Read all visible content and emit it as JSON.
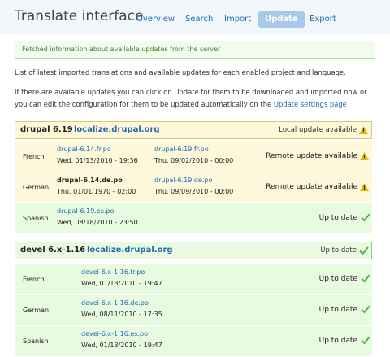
{
  "header": {
    "title": "Translate interface",
    "tabs": [
      "Overview",
      "Search",
      "Import",
      "Update",
      "Export"
    ],
    "active_tab": "Update"
  },
  "status_message": "Fetched information about available updates from the server",
  "intro": {
    "line1": "List of latest imported translations and available updates for each enabled project and language.",
    "line2_a": "If there are available updates you can click on Update for them to be downloaded and imported now or",
    "line2_b": "you can edit the configuration for them to be updated automatically on the",
    "link": "Update settings page"
  },
  "projects": [
    {
      "name": "drupal 6.19",
      "server": "localize.drupal.org",
      "status": "Local update available",
      "status_icon": "warning-icon",
      "rows": [
        {
          "language": "French",
          "local_file": "drupal-6.14.fr.po",
          "local_date": "Wed, 01/13/2010 - 19:36",
          "remote_file": "drupal-6.19.fr.po",
          "remote_date": "Thu, 09/02/2010 - 00:00",
          "status": "Remote update available",
          "icon": "warning-icon"
        },
        {
          "language": "German",
          "local_file": "drupal-6.14.de.po",
          "local_date": "Thu, 01/01/1970 - 02:00",
          "remote_file": "drupal-6.19.de.po",
          "remote_date": "Thu, 09/09/2010 - 00:00",
          "status": "Remote update available",
          "icon": "warning-icon"
        },
        {
          "language": "Spanish",
          "local_file": "drupal-6.19.es.po",
          "local_date": "Wed, 08/18/2010 - 23:50",
          "status": "Up to date",
          "icon": "check-icon"
        }
      ]
    },
    {
      "name": "devel 6.x-1.16",
      "server": "localize.drupal.org",
      "status": "Up to date",
      "status_icon": "check-icon",
      "rows": [
        {
          "language": "French",
          "local_file": "devel-6.x-1.16.fr.po",
          "local_date": "Wed, 01/13/2010 - 19:47",
          "status": "Up to date",
          "icon": "check-icon"
        },
        {
          "language": "German",
          "local_file": "devel-6.x-1.16.de.po",
          "local_date": "Wed, 08/11/2010 - 17:35",
          "status": "Up to date",
          "icon": "check-icon"
        },
        {
          "language": "Spanish",
          "local_file": "devel-6.x-1.16.es.po",
          "local_date": "Wed, 01/13/2010 - 19:47",
          "status": "Up to date",
          "icon": "check-icon"
        }
      ]
    }
  ],
  "colors": {
    "link": "#1f6ab3",
    "warning_bg": "#fdf8dc",
    "ok_bg": "#e8fbe1",
    "check": "#55b346",
    "warning": "#e8b800"
  }
}
